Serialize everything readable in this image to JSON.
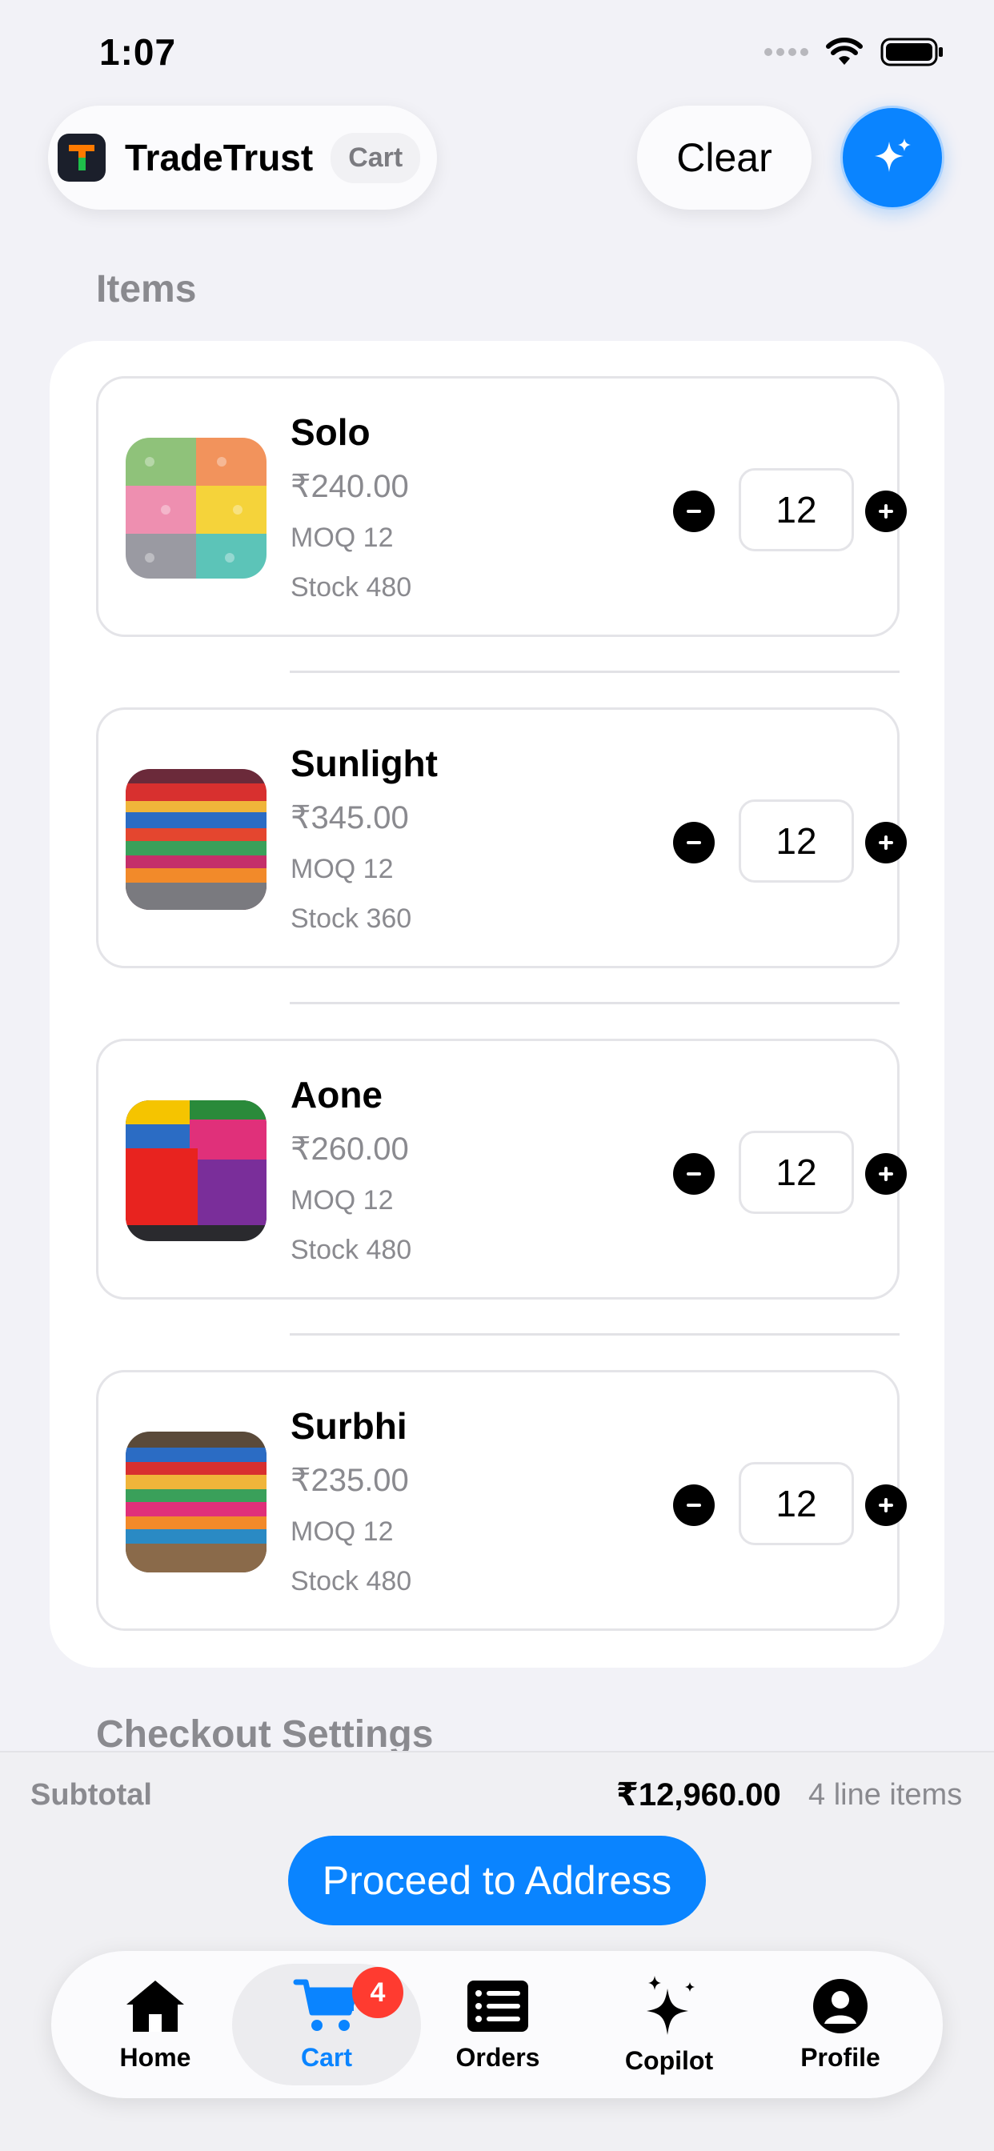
{
  "status_bar": {
    "time": "1:07"
  },
  "header": {
    "brand_name": "TradeTrust",
    "context_chip": "Cart",
    "clear_label": "Clear",
    "accent_color": "#0a84ff"
  },
  "items_section": {
    "title": "Items",
    "items": [
      {
        "name": "Solo",
        "price": "₹240.00",
        "moq": "MOQ 12",
        "stock": "Stock 480",
        "quantity": "12",
        "thumb_icon": "product-image"
      },
      {
        "name": "Sunlight",
        "price": "₹345.00",
        "moq": "MOQ 12",
        "stock": "Stock 360",
        "quantity": "12",
        "thumb_icon": "product-image"
      },
      {
        "name": "Aone",
        "price": "₹260.00",
        "moq": "MOQ 12",
        "stock": "Stock 480",
        "quantity": "12",
        "thumb_icon": "product-image"
      },
      {
        "name": "Surbhi",
        "price": "₹235.00",
        "moq": "MOQ 12",
        "stock": "Stock 480",
        "quantity": "12",
        "thumb_icon": "product-image"
      }
    ]
  },
  "checkout_section": {
    "title": "Checkout Settings"
  },
  "summary": {
    "subtotal_label": "Subtotal",
    "subtotal_value": "₹12,960.00",
    "line_items": "4 line items",
    "proceed_label": "Proceed to Address"
  },
  "tab_bar": {
    "active": "Cart",
    "cart_badge": "4",
    "tabs": [
      {
        "label": "Home",
        "icon": "house-icon"
      },
      {
        "label": "Cart",
        "icon": "cart-icon"
      },
      {
        "label": "Orders",
        "icon": "list-icon"
      },
      {
        "label": "Copilot",
        "icon": "sparkles-icon"
      },
      {
        "label": "Profile",
        "icon": "person-icon"
      }
    ]
  }
}
